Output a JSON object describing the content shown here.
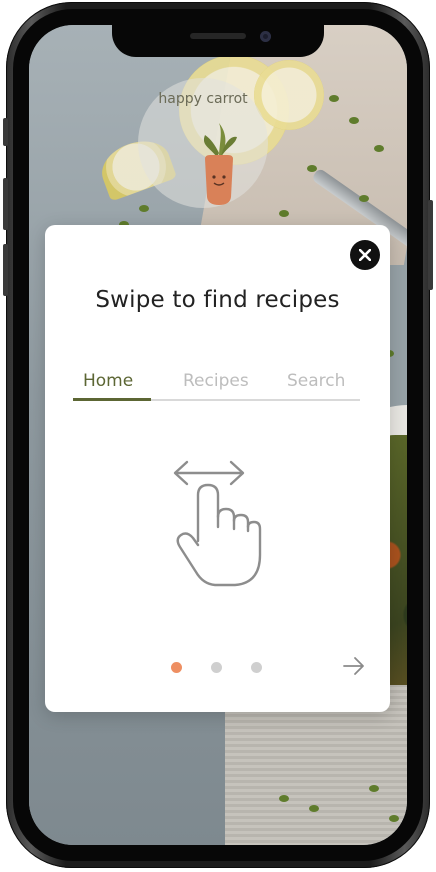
{
  "app": {
    "logo_text": "happy carrot"
  },
  "modal": {
    "title": "Swipe to find recipes",
    "tabs": [
      {
        "label": "Home",
        "active": true
      },
      {
        "label": "Recipes",
        "active": false
      },
      {
        "label": "Search",
        "active": false
      }
    ],
    "illustration": "swipe-gesture-icon",
    "pagination": {
      "total_pages": 3,
      "current_page": 1
    },
    "close_icon": "close-icon",
    "next_icon": "arrow-right-icon"
  },
  "colors": {
    "accent": "#5c6634",
    "active_dot": "#ee8f62",
    "inactive_dot": "#cfcfcf",
    "inactive_tab": "#bdbdbd",
    "close_button": "#111111",
    "carrot": "#d98158",
    "leaves": "#6a7d34"
  }
}
